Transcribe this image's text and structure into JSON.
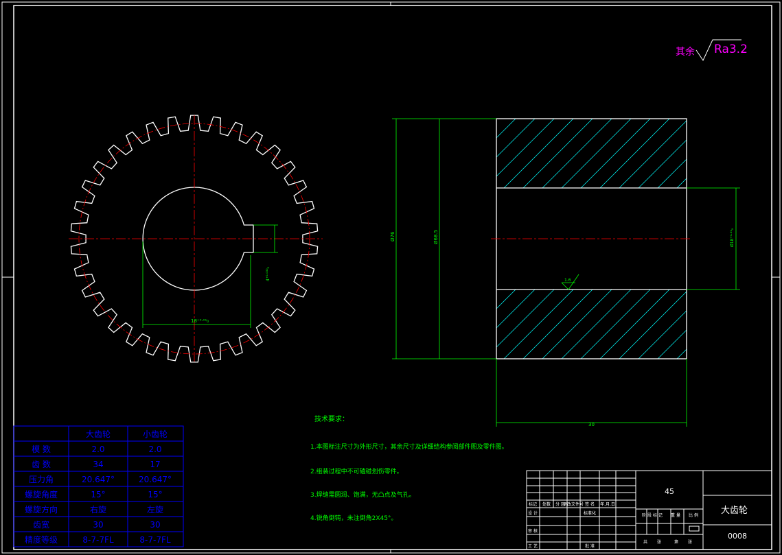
{
  "roughness": {
    "prefix": "其余",
    "value": "Ra3.2"
  },
  "gear_view": {
    "teeth": 34,
    "keyway_dim": "4⁺⁰·⁰³⁰₀",
    "bore_dim": "18⁺⁰·⁰¹₀"
  },
  "section_view": {
    "dim_outer": "Ø76",
    "dim_root": "Ø68.5",
    "dim_bore": "Ø18⁺⁰·⁰¹₀",
    "dim_width": "30",
    "surface_mark": "1.6"
  },
  "tech_requirements": {
    "title": "技术要求：",
    "items": [
      "1.本图标注尺寸为外形尺寸，其余尺寸及详细结构参阅部件图及零件图。",
      "2.组装过程中不可磕碰划伤零件。",
      "3.焊缝需圆润、饱满，无凸点及气孔。",
      "4.锐角倒钝，未注倒角2X45°。"
    ]
  },
  "param_table": {
    "headers": [
      "",
      "大齿轮",
      "小齿轮"
    ],
    "rows": [
      [
        "模  数",
        "2.0",
        "2.0"
      ],
      [
        "齿  数",
        "34",
        "17"
      ],
      [
        "压力角",
        "20.647°",
        "20.647°"
      ],
      [
        "螺旋角度",
        "15°",
        "15°"
      ],
      [
        "螺旋方向",
        "右旋",
        "左旋"
      ],
      [
        "齿宽",
        "30",
        "30"
      ],
      [
        "精度等级",
        "8-7-7FL",
        "8-7-7FL"
      ]
    ]
  },
  "title_block": {
    "material": "45",
    "part_name": "大齿轮",
    "drawing_no": "0008",
    "sm_row1": [
      "标记",
      "处数",
      "分 区",
      "更改文件号",
      "签 名",
      "年.月.日"
    ],
    "sm_row2": [
      "设 计",
      "",
      "",
      "标准化",
      "",
      ""
    ],
    "sm_row3": [
      "审 核",
      "",
      "",
      "",
      "",
      ""
    ],
    "sm_row4": [
      "工 艺",
      "",
      "",
      "批 准",
      "",
      ""
    ],
    "stage_labels": [
      "阶 段 标 记",
      "重 量",
      "比 例"
    ],
    "bottom_labels": [
      "共",
      "张",
      "第",
      "张"
    ]
  },
  "colors": {
    "border": "#ffffff",
    "outline": "#ffffff",
    "dimension": "#00ff00",
    "centerline": "#ff0000",
    "hatch": "#00ffff",
    "table": "#0000ff",
    "annotation": "#ff00ff"
  }
}
